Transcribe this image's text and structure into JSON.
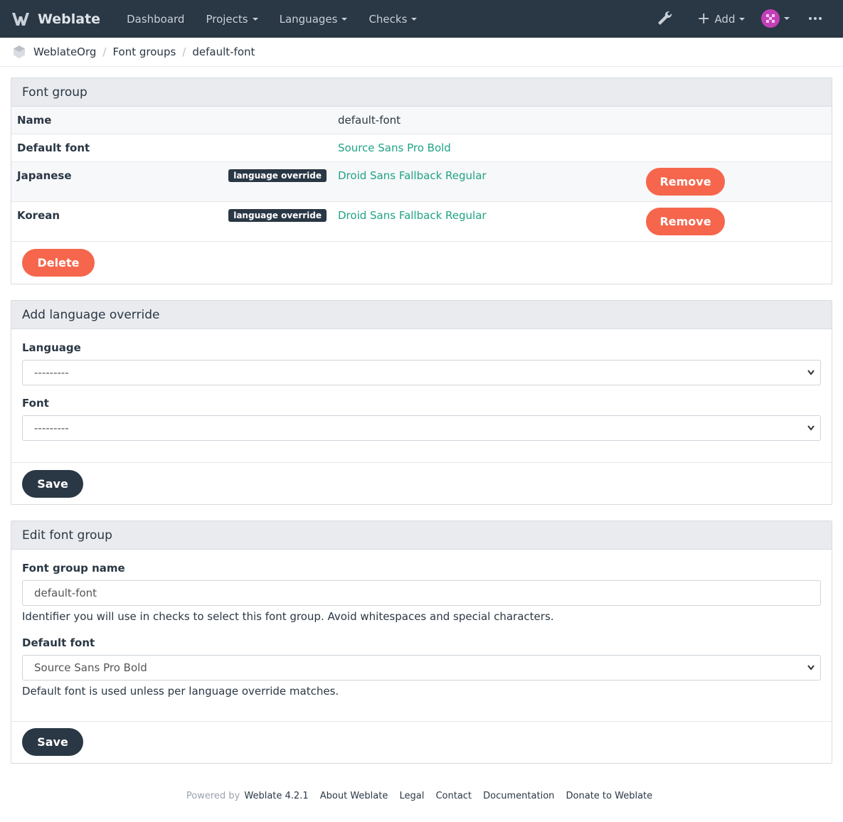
{
  "navbar": {
    "brand": "Weblate",
    "items": [
      {
        "label": "Dashboard",
        "caret": false
      },
      {
        "label": "Projects",
        "caret": true
      },
      {
        "label": "Languages",
        "caret": true
      },
      {
        "label": "Checks",
        "caret": true
      }
    ],
    "add_label": "Add"
  },
  "breadcrumb": [
    "WeblateOrg",
    "Font groups",
    "default-font"
  ],
  "font_group": {
    "heading": "Font group",
    "rows": [
      {
        "label": "Name",
        "value": "default-font"
      },
      {
        "label": "Default font",
        "value": "Source Sans Pro Bold"
      },
      {
        "label": "Japanese",
        "badge": "language override",
        "value": "Droid Sans Fallback Regular",
        "action": "Remove"
      },
      {
        "label": "Korean",
        "badge": "language override",
        "value": "Droid Sans Fallback Regular",
        "action": "Remove"
      }
    ],
    "delete_label": "Delete"
  },
  "add_override": {
    "heading": "Add language override",
    "language_label": "Language",
    "language_value": "---------",
    "font_label": "Font",
    "font_value": "---------",
    "save_label": "Save"
  },
  "edit_group": {
    "heading": "Edit font group",
    "name_label": "Font group name",
    "name_value": "default-font",
    "name_help": "Identifier you will use in checks to select this font group. Avoid whitespaces and special characters.",
    "default_label": "Default font",
    "default_value": "Source Sans Pro Bold",
    "default_help": "Default font is used unless per language override matches.",
    "save_label": "Save"
  },
  "footer": {
    "powered_by": "Powered by",
    "version": "Weblate 4.2.1",
    "links": [
      "About Weblate",
      "Legal",
      "Contact",
      "Documentation",
      "Donate to Weblate"
    ]
  },
  "colors": {
    "navbar": "#2a3744",
    "accent": "#1fa385",
    "danger": "#f6664c"
  }
}
